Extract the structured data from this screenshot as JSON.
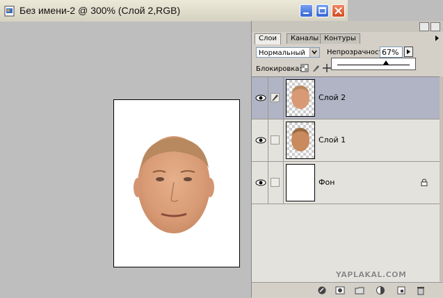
{
  "window": {
    "title": "Без имени-2 @ 300% (Слой 2,RGB)"
  },
  "palette": {
    "tabs": [
      {
        "label": "Слои",
        "active": true
      },
      {
        "label": "Каналы",
        "active": false
      },
      {
        "label": "Контуры",
        "active": false
      }
    ],
    "blend_mode": "Нормальный",
    "opacity_label": "Непрозрачность:",
    "opacity_value": "67%",
    "opacity_fraction": 0.67,
    "lock_label": "Блокировка:",
    "layers": [
      {
        "name": "Слой 2",
        "selected": true,
        "visible": true,
        "thumb": "face",
        "locked": false
      },
      {
        "name": "Слой 1",
        "selected": false,
        "visible": true,
        "thumb": "face",
        "locked": false
      },
      {
        "name": "Фон",
        "selected": false,
        "visible": true,
        "thumb": "white",
        "locked": true
      }
    ],
    "bottom_icons": [
      "layer-style-icon",
      "mask-icon",
      "folder-icon",
      "adjustment-layer-icon",
      "new-layer-icon",
      "trash-icon"
    ]
  },
  "watermark": "YAPLAKAL.COM",
  "colors": {
    "selected_layer": "#b0b4c4",
    "close_button": "#d24a22"
  }
}
